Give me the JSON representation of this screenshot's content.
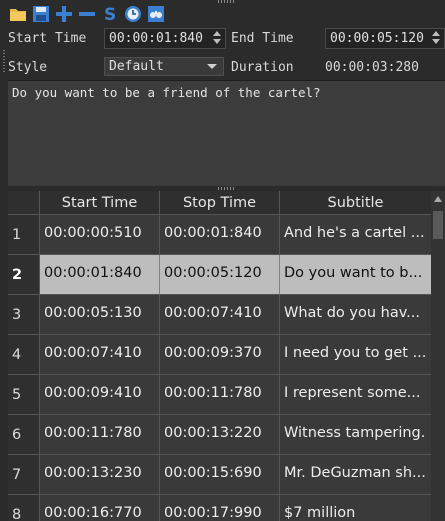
{
  "toolbar": [
    {
      "name": "open-folder-icon",
      "color": "#e8b84a"
    },
    {
      "name": "save-icon",
      "color": "#3b7fd0"
    },
    {
      "name": "add-icon",
      "color": "#3b7fd0"
    },
    {
      "name": "remove-icon",
      "color": "#3b7fd0"
    },
    {
      "name": "spellcheck-icon",
      "color": "#3b7fd0"
    },
    {
      "name": "clock-icon",
      "color": "#3b7fd0"
    },
    {
      "name": "find-icon",
      "color": "#3b7fd0"
    }
  ],
  "fields": {
    "start_time_label": "Start Time",
    "start_time_value": "00:00:01:840",
    "end_time_label": "End Time",
    "end_time_value": "00:00:05:120",
    "style_label": "Style",
    "style_value": "Default",
    "duration_label": "Duration",
    "duration_value": "00:00:03:280"
  },
  "editor": {
    "text": "Do you want to be a friend of the cartel?"
  },
  "table": {
    "headers": {
      "start": "Start Time",
      "stop": "Stop Time",
      "subtitle": "Subtitle"
    },
    "rows": [
      {
        "num": "1",
        "start": "00:00:00:510",
        "stop": "00:00:01:840",
        "subtitle": "And he's a cartel ..."
      },
      {
        "num": "2",
        "start": "00:00:01:840",
        "stop": "00:00:05:120",
        "subtitle": "Do you want to b..."
      },
      {
        "num": "3",
        "start": "00:00:05:130",
        "stop": "00:00:07:410",
        "subtitle": "What do you hav..."
      },
      {
        "num": "4",
        "start": "00:00:07:410",
        "stop": "00:00:09:370",
        "subtitle": "I need you to get ..."
      },
      {
        "num": "5",
        "start": "00:00:09:410",
        "stop": "00:00:11:780",
        "subtitle": "I represent some..."
      },
      {
        "num": "6",
        "start": "00:00:11:780",
        "stop": "00:00:13:220",
        "subtitle": "Witness tampering."
      },
      {
        "num": "7",
        "start": "00:00:13:230",
        "stop": "00:00:15:690",
        "subtitle": "Mr. DeGuzman sh..."
      },
      {
        "num": "8",
        "start": "00:00:16:770",
        "stop": "00:00:17:990",
        "subtitle": "$7 million"
      }
    ],
    "selected_index": 1
  }
}
